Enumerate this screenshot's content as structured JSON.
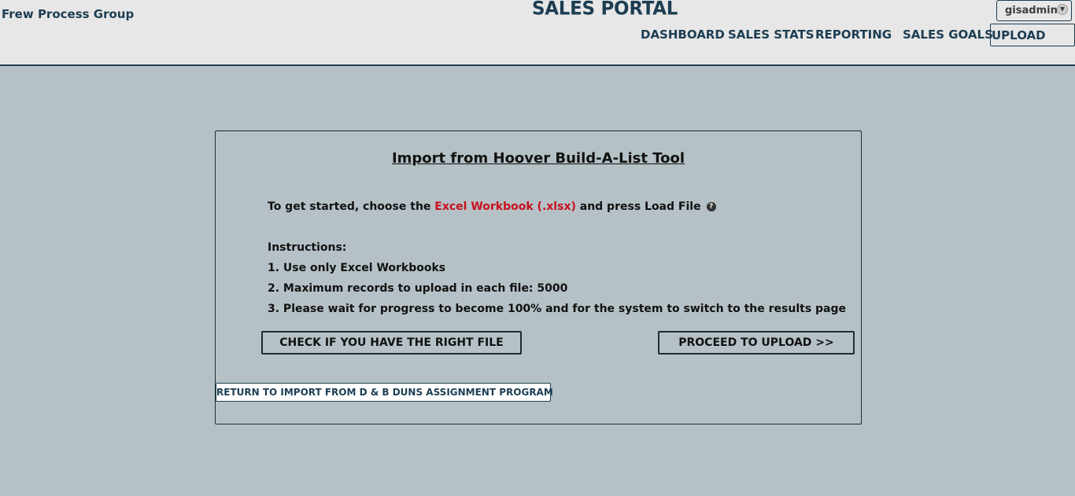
{
  "header": {
    "company": "Frew Process Group",
    "title": "SALES PORTAL",
    "user": {
      "name": "gisadmin",
      "caret_icon": "chevron-down-icon"
    },
    "nav": {
      "dashboard": "DASHBOARD",
      "sales_stats": "SALES STATS",
      "reporting": "REPORTING",
      "sales_goals": "SALES GOALS",
      "upload": "UPLOAD"
    }
  },
  "panel": {
    "title": "Import from Hoover Build-A-List Tool",
    "intro": {
      "prefix": "To get started, choose the ",
      "highlight": "Excel Workbook (.xlsx)",
      "suffix": " and press Load File",
      "help_icon": "question-icon"
    },
    "instructions": {
      "heading": "Instructions:",
      "items": [
        "1. Use only Excel Workbooks",
        "2. Maximum records to upload in each file: 5000",
        "3. Please wait for progress to become 100% and for the system to switch to the results page"
      ]
    },
    "buttons": {
      "check": "CHECK IF YOU HAVE THE RIGHT FILE",
      "proceed": "PROCEED TO UPLOAD >>",
      "return": "RETURN TO IMPORT FROM D & B DUNS ASSIGNMENT PROGRAM"
    }
  },
  "colors": {
    "header_bg": "#e7e7e7",
    "page_bg": "#b5c1c6",
    "brand_navy": "#1c3d52",
    "highlight_red": "#c8101e"
  }
}
